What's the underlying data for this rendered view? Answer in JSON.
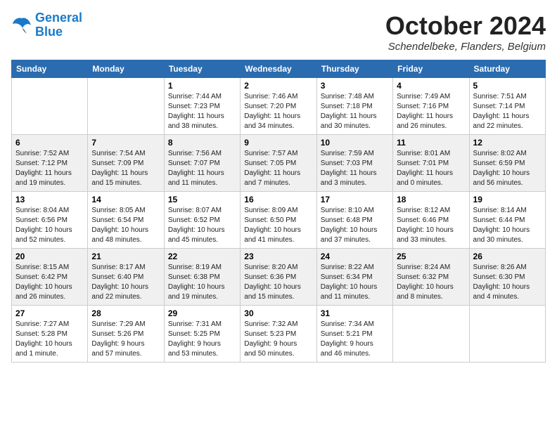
{
  "header": {
    "logo_line1": "General",
    "logo_line2": "Blue",
    "month": "October 2024",
    "location": "Schendelbeke, Flanders, Belgium"
  },
  "weekdays": [
    "Sunday",
    "Monday",
    "Tuesday",
    "Wednesday",
    "Thursday",
    "Friday",
    "Saturday"
  ],
  "weeks": [
    [
      {
        "day": "",
        "info": ""
      },
      {
        "day": "",
        "info": ""
      },
      {
        "day": "1",
        "info": "Sunrise: 7:44 AM\nSunset: 7:23 PM\nDaylight: 11 hours\nand 38 minutes."
      },
      {
        "day": "2",
        "info": "Sunrise: 7:46 AM\nSunset: 7:20 PM\nDaylight: 11 hours\nand 34 minutes."
      },
      {
        "day": "3",
        "info": "Sunrise: 7:48 AM\nSunset: 7:18 PM\nDaylight: 11 hours\nand 30 minutes."
      },
      {
        "day": "4",
        "info": "Sunrise: 7:49 AM\nSunset: 7:16 PM\nDaylight: 11 hours\nand 26 minutes."
      },
      {
        "day": "5",
        "info": "Sunrise: 7:51 AM\nSunset: 7:14 PM\nDaylight: 11 hours\nand 22 minutes."
      }
    ],
    [
      {
        "day": "6",
        "info": "Sunrise: 7:52 AM\nSunset: 7:12 PM\nDaylight: 11 hours\nand 19 minutes."
      },
      {
        "day": "7",
        "info": "Sunrise: 7:54 AM\nSunset: 7:09 PM\nDaylight: 11 hours\nand 15 minutes."
      },
      {
        "day": "8",
        "info": "Sunrise: 7:56 AM\nSunset: 7:07 PM\nDaylight: 11 hours\nand 11 minutes."
      },
      {
        "day": "9",
        "info": "Sunrise: 7:57 AM\nSunset: 7:05 PM\nDaylight: 11 hours\nand 7 minutes."
      },
      {
        "day": "10",
        "info": "Sunrise: 7:59 AM\nSunset: 7:03 PM\nDaylight: 11 hours\nand 3 minutes."
      },
      {
        "day": "11",
        "info": "Sunrise: 8:01 AM\nSunset: 7:01 PM\nDaylight: 11 hours\nand 0 minutes."
      },
      {
        "day": "12",
        "info": "Sunrise: 8:02 AM\nSunset: 6:59 PM\nDaylight: 10 hours\nand 56 minutes."
      }
    ],
    [
      {
        "day": "13",
        "info": "Sunrise: 8:04 AM\nSunset: 6:56 PM\nDaylight: 10 hours\nand 52 minutes."
      },
      {
        "day": "14",
        "info": "Sunrise: 8:05 AM\nSunset: 6:54 PM\nDaylight: 10 hours\nand 48 minutes."
      },
      {
        "day": "15",
        "info": "Sunrise: 8:07 AM\nSunset: 6:52 PM\nDaylight: 10 hours\nand 45 minutes."
      },
      {
        "day": "16",
        "info": "Sunrise: 8:09 AM\nSunset: 6:50 PM\nDaylight: 10 hours\nand 41 minutes."
      },
      {
        "day": "17",
        "info": "Sunrise: 8:10 AM\nSunset: 6:48 PM\nDaylight: 10 hours\nand 37 minutes."
      },
      {
        "day": "18",
        "info": "Sunrise: 8:12 AM\nSunset: 6:46 PM\nDaylight: 10 hours\nand 33 minutes."
      },
      {
        "day": "19",
        "info": "Sunrise: 8:14 AM\nSunset: 6:44 PM\nDaylight: 10 hours\nand 30 minutes."
      }
    ],
    [
      {
        "day": "20",
        "info": "Sunrise: 8:15 AM\nSunset: 6:42 PM\nDaylight: 10 hours\nand 26 minutes."
      },
      {
        "day": "21",
        "info": "Sunrise: 8:17 AM\nSunset: 6:40 PM\nDaylight: 10 hours\nand 22 minutes."
      },
      {
        "day": "22",
        "info": "Sunrise: 8:19 AM\nSunset: 6:38 PM\nDaylight: 10 hours\nand 19 minutes."
      },
      {
        "day": "23",
        "info": "Sunrise: 8:20 AM\nSunset: 6:36 PM\nDaylight: 10 hours\nand 15 minutes."
      },
      {
        "day": "24",
        "info": "Sunrise: 8:22 AM\nSunset: 6:34 PM\nDaylight: 10 hours\nand 11 minutes."
      },
      {
        "day": "25",
        "info": "Sunrise: 8:24 AM\nSunset: 6:32 PM\nDaylight: 10 hours\nand 8 minutes."
      },
      {
        "day": "26",
        "info": "Sunrise: 8:26 AM\nSunset: 6:30 PM\nDaylight: 10 hours\nand 4 minutes."
      }
    ],
    [
      {
        "day": "27",
        "info": "Sunrise: 7:27 AM\nSunset: 5:28 PM\nDaylight: 10 hours\nand 1 minute."
      },
      {
        "day": "28",
        "info": "Sunrise: 7:29 AM\nSunset: 5:26 PM\nDaylight: 9 hours\nand 57 minutes."
      },
      {
        "day": "29",
        "info": "Sunrise: 7:31 AM\nSunset: 5:25 PM\nDaylight: 9 hours\nand 53 minutes."
      },
      {
        "day": "30",
        "info": "Sunrise: 7:32 AM\nSunset: 5:23 PM\nDaylight: 9 hours\nand 50 minutes."
      },
      {
        "day": "31",
        "info": "Sunrise: 7:34 AM\nSunset: 5:21 PM\nDaylight: 9 hours\nand 46 minutes."
      },
      {
        "day": "",
        "info": ""
      },
      {
        "day": "",
        "info": ""
      }
    ]
  ]
}
